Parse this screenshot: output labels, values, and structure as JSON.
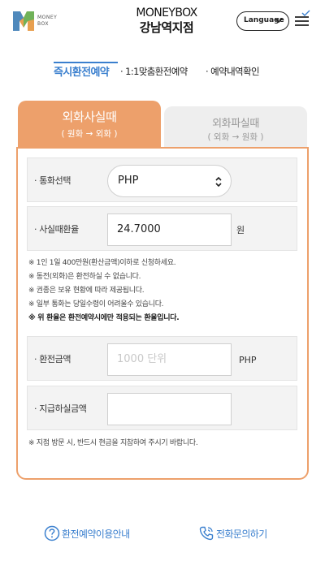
{
  "header": {
    "logo_text_line1": "MONEY",
    "logo_text_line2": "BOX",
    "brand_line1": "MONEYBOX",
    "brand_line2": "강남역지점",
    "language_label": "Language"
  },
  "nav": {
    "tab1": "즉시환전예약",
    "tab2": "· 1:1맞춤환전예약",
    "tab3": "· 예약내역확인"
  },
  "trade_tabs": {
    "buy_title": "외화사실때",
    "buy_sub": "( 원화 → 외화 )",
    "sell_title": "외화파실때",
    "sell_sub": "( 외화 → 원화 )"
  },
  "form": {
    "currency_label": "· 통화선택",
    "currency_value": "PHP",
    "rate_label": "· 사실때환율",
    "rate_value": "24.7000",
    "rate_unit": "원",
    "amount_label": "· 환전금액",
    "amount_placeholder": "1000 단위",
    "amount_unit": "PHP",
    "pay_label": "· 지급하실금액",
    "pay_value": ""
  },
  "notes": [
    "※ 1인 1일 400만원(환산금액)이하로 신청하세요.",
    "※ 동전(외화)은 환전하실 수 없습니다.",
    "※ 권종은 보유 현황에 따라 제공됩니다.",
    "※ 일부 통화는 당일수령이 어려울수 있습니다.",
    "※ 위 환율은 환전예약시에만 적용되는 환율입니다."
  ],
  "bottom_note": "※ 지점 방문 시, 반드시 현금을 지참하여 주시기 바랍니다.",
  "footer": {
    "guide_label": "환전예약이용안내",
    "call_label": "전화문의하기"
  },
  "colors": {
    "accent_orange": "#eda06b",
    "accent_blue": "#3a7fce"
  }
}
